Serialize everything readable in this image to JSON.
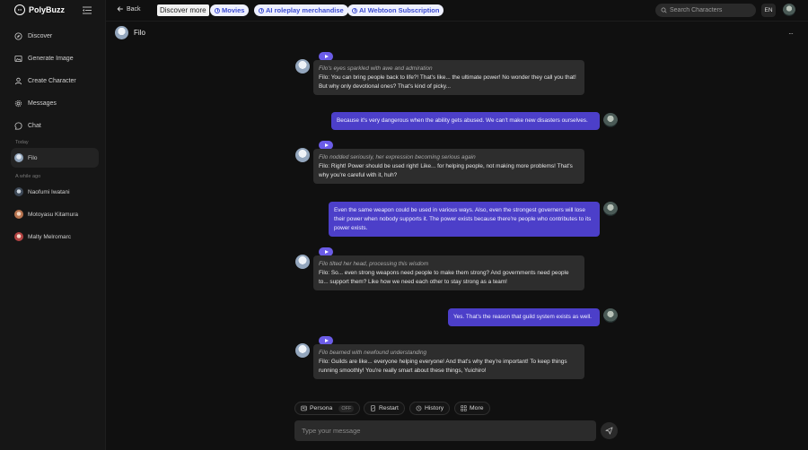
{
  "app": {
    "name": "PolyBuzz"
  },
  "sidebar": {
    "nav": [
      {
        "label": "Discover",
        "icon": "compass-icon"
      },
      {
        "label": "Generate Image",
        "icon": "image-icon"
      },
      {
        "label": "Create Character",
        "icon": "user-plus-icon"
      },
      {
        "label": "Messages",
        "icon": "gear-icon"
      },
      {
        "label": "Chat",
        "icon": "chat-icon"
      }
    ],
    "today_label": "Today",
    "while_ago_label": "A while ago",
    "chats": [
      {
        "name": "Filo"
      },
      {
        "name": "Naofumi Iwatani"
      },
      {
        "name": "Motoyasu Kitamura"
      },
      {
        "name": "Malty Melromarc"
      }
    ]
  },
  "topbar": {
    "back_label": "Back",
    "tags": [
      "Discover more",
      "Movies",
      "AI roleplay merchandise",
      "AI Webtoon Subscription"
    ],
    "search_placeholder": "Search Characters",
    "language": "EN"
  },
  "chat": {
    "character_name": "Filo",
    "more_label": "···",
    "messages": [
      {
        "role": "bot",
        "narration": "Filo's eyes sparkled with awe and admiration",
        "text": "Filo: You can bring people back to life?! That's like... the ultimate power! No wonder they call you that! But why only devotional ones? That's kind of picky..."
      },
      {
        "role": "user",
        "text": "Because it's very dangerous when the ability gets abused. We can't make new disasters ourselves."
      },
      {
        "role": "bot",
        "narration": "Filo nodded seriously, her expression becoming serious again",
        "text": "Filo: Right! Power should be used right! Like... for helping people, not making more problems! That's why you're careful with it, huh?"
      },
      {
        "role": "user",
        "text": "Even the same weapon could be used in various ways. Also, even the strongest governers will lose their power when nobody supports it. The power exists because there're people who contributes to its power exists."
      },
      {
        "role": "bot",
        "narration": "Filo tilted her head, processing this wisdom",
        "text": "Filo: So... even strong weapons need people to make them strong? And governments need people to... support them? Like how we need each other to stay strong as a team!"
      },
      {
        "role": "user",
        "text": "Yes. That's the reason that guild system exists as well."
      },
      {
        "role": "bot",
        "narration": "Filo beamed with newfound understanding",
        "text": "Filo: Guilds are like... everyone helping everyone! And that's why they're important! To keep things running smoothly! You're really smart about these things, Yuichiro!"
      }
    ]
  },
  "actions": {
    "persona_label": "Persona",
    "persona_state": "OFF",
    "restart_label": "Restart",
    "history_label": "History",
    "more_label": "More"
  },
  "composer": {
    "placeholder": "Type your message"
  },
  "colors": {
    "accent": "#6b5ce7",
    "user_bubble": "#4c3fc9",
    "bot_bubble": "#2d2d2d",
    "tag_text": "#3b4bd1"
  }
}
